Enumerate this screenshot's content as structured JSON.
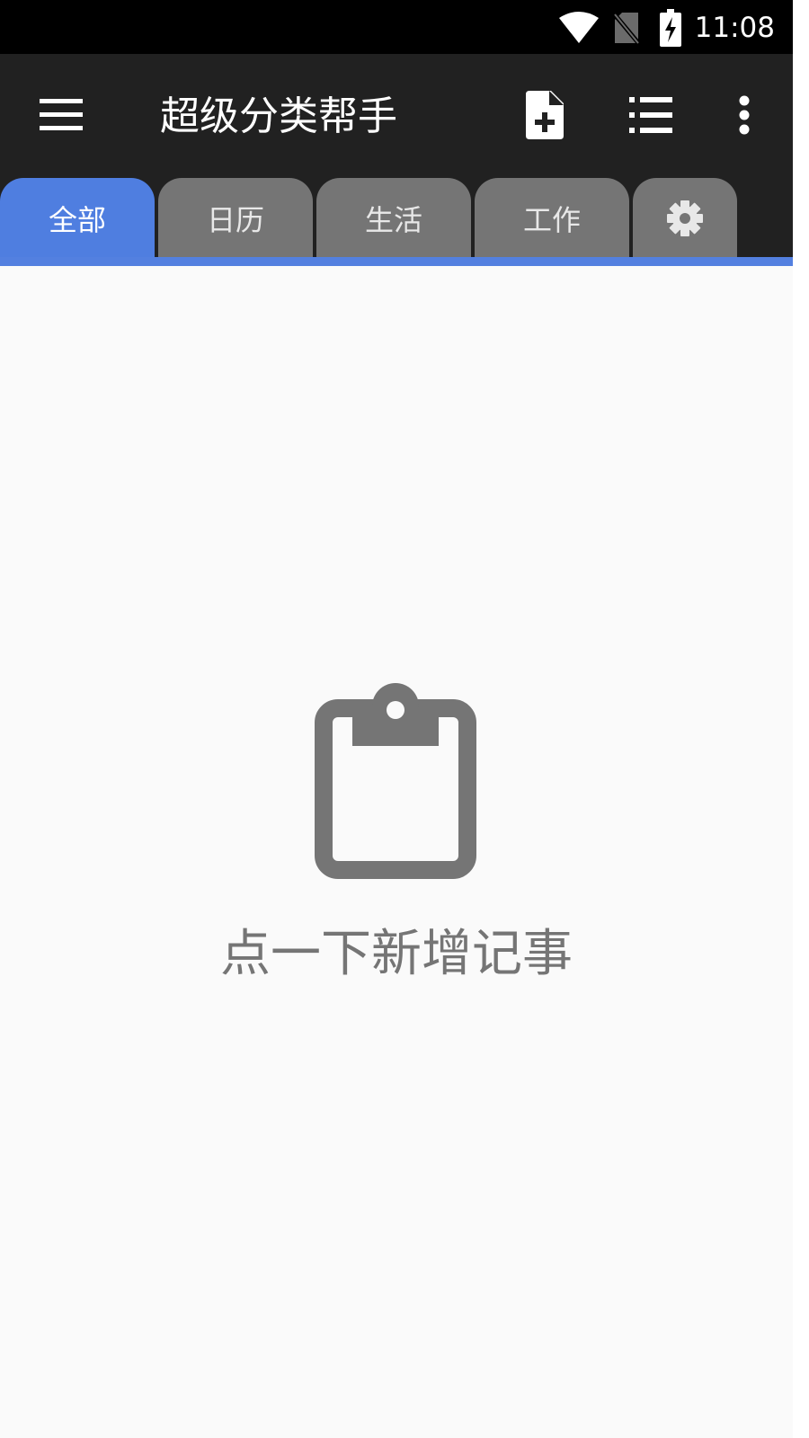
{
  "status_bar": {
    "time": "11:08",
    "icons": [
      "wifi-icon",
      "no-sim-icon",
      "battery-charging-icon"
    ]
  },
  "app_bar": {
    "title": "超级分类帮手",
    "icons": [
      "menu-icon",
      "add-note-icon",
      "list-icon",
      "more-vert-icon"
    ]
  },
  "tabs": [
    {
      "label": "全部",
      "active": true
    },
    {
      "label": "日历",
      "active": false
    },
    {
      "label": "生活",
      "active": false
    },
    {
      "label": "工作",
      "active": false
    },
    {
      "icon": "settings-icon",
      "active": false
    }
  ],
  "colors": {
    "app_bar_bg": "#212121",
    "active_tab": "#4f7ee0",
    "inactive_tab": "#757575",
    "empty_state": "#757575",
    "content_bg": "#fafafa"
  },
  "empty_state": {
    "icon": "clipboard-icon",
    "message": "点一下新增记事"
  }
}
